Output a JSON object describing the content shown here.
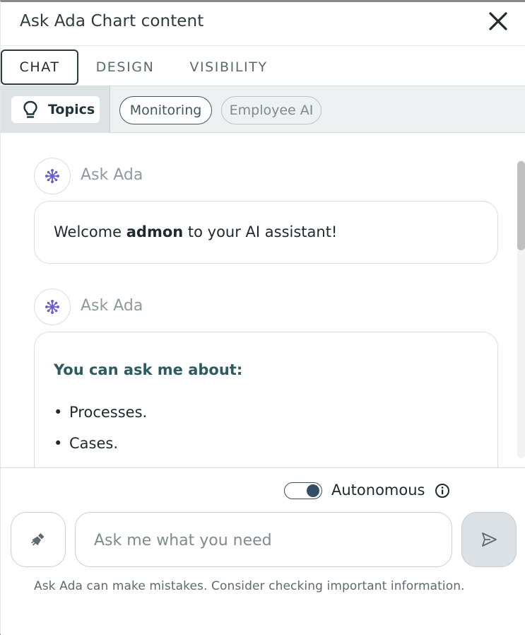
{
  "header": {
    "title": "Ask Ada Chart content",
    "close_icon": "close-icon"
  },
  "tabs": [
    {
      "label": "CHAT",
      "active": true
    },
    {
      "label": "DESIGN",
      "active": false
    },
    {
      "label": "VISIBILITY",
      "active": false
    }
  ],
  "topics": {
    "button_label": "Topics",
    "icon": "lightbulb-icon",
    "chips": [
      {
        "label": "Monitoring",
        "selected": true
      },
      {
        "label": "Employee AI",
        "selected": false
      }
    ]
  },
  "messages": [
    {
      "sender": "Ask Ada",
      "avatar_icon": "network-node-icon",
      "text_before": "Welcome ",
      "text_bold": "admon",
      "text_after": " to your AI assistant!"
    },
    {
      "sender": "Ask Ada",
      "avatar_icon": "network-node-icon",
      "heading": "You can ask me about:",
      "items": [
        "Processes.",
        "Cases."
      ]
    }
  ],
  "footer": {
    "autonomous_label": "Autonomous",
    "autonomous_on": true,
    "info_icon": "info-icon",
    "clean_icon": "broom-icon",
    "input_placeholder": "Ask me what you need",
    "input_value": "",
    "send_icon": "send-icon",
    "disclaimer": "Ask Ada can make mistakes. Consider checking important information."
  },
  "colors": {
    "accent_dark": "#2d3a3f",
    "toggle_knob": "#344d67",
    "heading_teal": "#2d5c60",
    "avatar_icon": "#6a5fd1"
  }
}
